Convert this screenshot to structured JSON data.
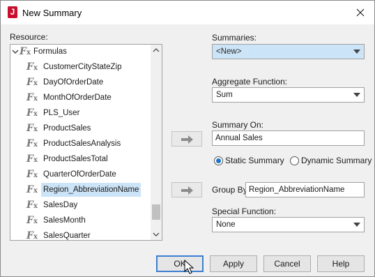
{
  "window": {
    "title": "New Summary"
  },
  "resource": {
    "label": "Resource:",
    "root": "Formulas",
    "items": [
      "CustomerCityStateZip",
      "DayOfOrderDate",
      "MonthOfOrderDate",
      "PLS_User",
      "ProductSales",
      "ProductSalesAnalysis",
      "ProductSalesTotal",
      "QuarterOfOrderDate",
      "Region_AbbreviationName",
      "SalesDay",
      "SalesMonth",
      "SalesQuarter"
    ],
    "selected": "Region_AbbreviationName"
  },
  "summaries": {
    "label": "Summaries:",
    "value": "<New>"
  },
  "aggregate": {
    "label": "Aggregate Function:",
    "value": "Sum"
  },
  "summary_on": {
    "label": "Summary On:",
    "value": "Annual Sales"
  },
  "options": {
    "static": "Static Summary",
    "dynamic": "Dynamic Summary",
    "selected": "static"
  },
  "group_by": {
    "label": "Group By",
    "value": "Region_AbbreviationName"
  },
  "special": {
    "label": "Special Function:",
    "value": "None"
  },
  "buttons": {
    "ok": "OK",
    "apply": "Apply",
    "cancel": "Cancel",
    "help": "Help"
  },
  "colors": {
    "accent": "#1a73c8",
    "selection": "#cce4f7",
    "brand_icon": "#c8102e"
  }
}
